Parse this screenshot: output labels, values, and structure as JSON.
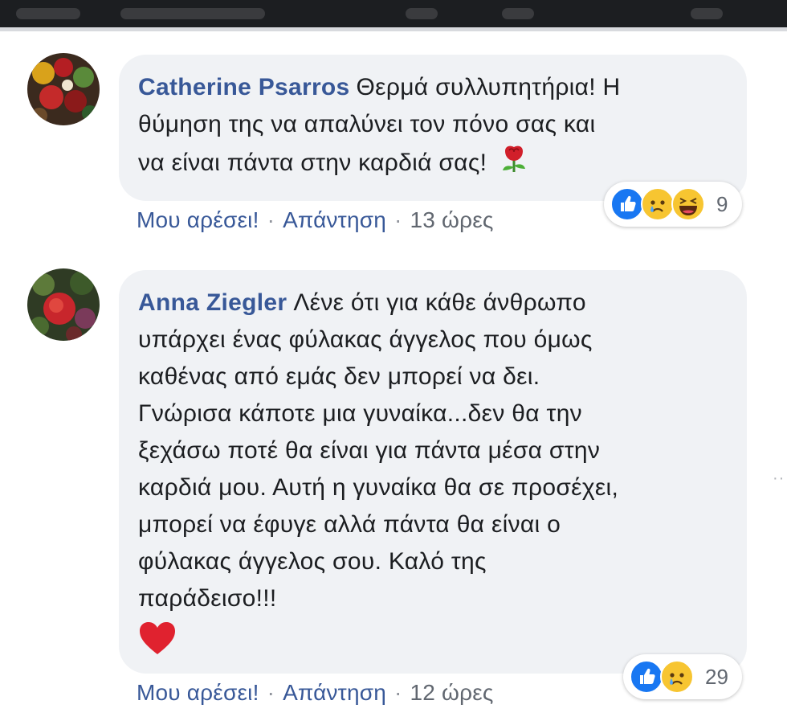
{
  "comments": [
    {
      "author": "Catherine Psarros",
      "lines": [
        "Θερμά συλλυπητήρια! Η",
        "θύμηση της να απαλύνει τον πόνο σας και",
        "να είναι πάντα στην καρδιά σας!"
      ],
      "end_emoji": "rose-icon",
      "like_label": "Μου αρέσει!",
      "separator": "·",
      "reply_label": "Απάντηση",
      "time": "13 ώρες",
      "reactions": [
        "like-icon",
        "sad-icon",
        "haha-icon"
      ],
      "reaction_count": "9"
    },
    {
      "author": "Anna Ziegler",
      "lines": [
        "Λένε ότι για κάθε άνθρωπο",
        "υπάρχει ένας φύλακας άγγελος που όμως",
        "καθένας από εμάς δεν μπορεί να δει.",
        "Γνώρισα κάποτε μια γυναίκα...δεν θα την",
        "ξεχάσω ποτέ θα είναι για πάντα μέσα στην",
        "καρδιά μου. Αυτή η γυναίκα θα σε προσέχει,",
        "μπορεί να έφυγε αλλά πάντα θα είναι ο",
        "φύλακας άγγελος σου. Καλό της",
        "παράδεισο!!!"
      ],
      "end_emoji": "heart-icon",
      "like_label": "Μου αρέσει!",
      "separator": "·",
      "reply_label": "Απάντηση",
      "time": "12 ώρες",
      "reactions": [
        "like-icon",
        "sad-icon"
      ],
      "reaction_count": "29"
    }
  ],
  "colors": {
    "author": "#385898",
    "bubble": "#f0f2f5",
    "text": "#1c1e21",
    "like_blue": "#1877f2",
    "emoji_yellow": "#f7c531",
    "heart_red": "#e0222f"
  }
}
